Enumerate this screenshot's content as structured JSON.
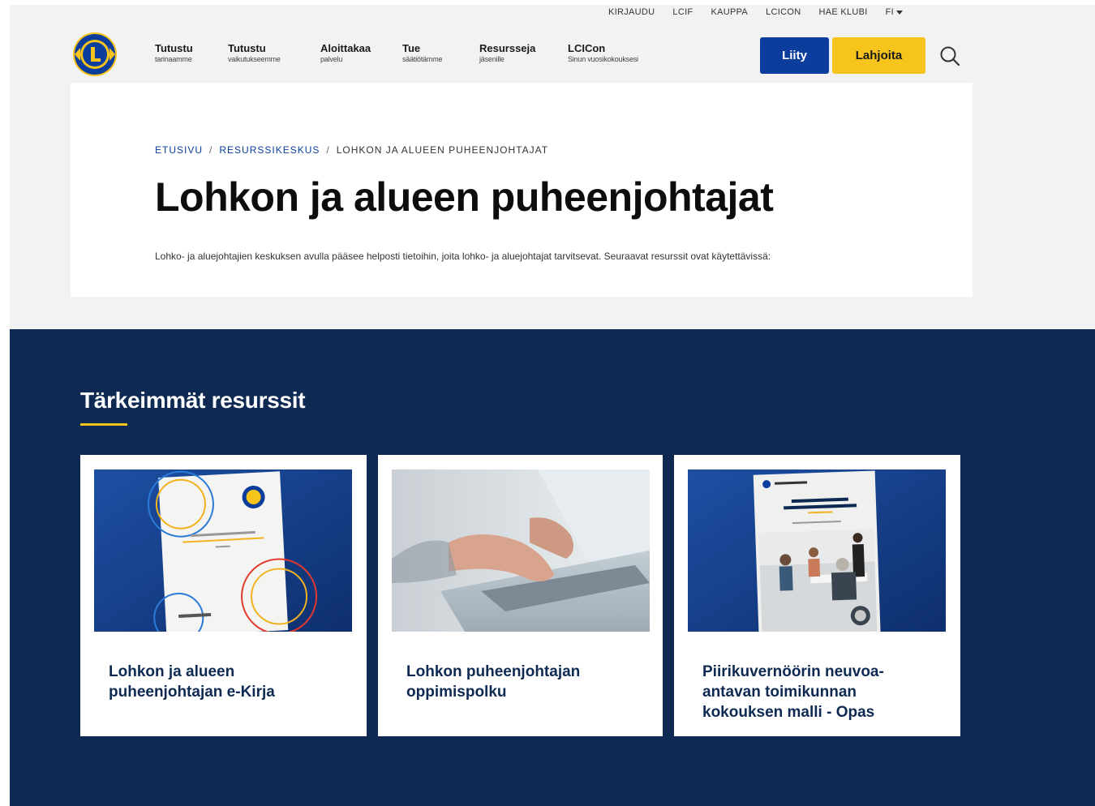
{
  "utility_nav": {
    "items": [
      "KIRJAUDU",
      "LCIF",
      "KAUPPA",
      "LCICON",
      "HAE KLUBI"
    ],
    "language": "FI"
  },
  "main_nav": {
    "items": [
      {
        "title": "Tutustu",
        "subtitle": "tarinaamme"
      },
      {
        "title": "Tutustu",
        "subtitle": "vaikutukseemme"
      },
      {
        "title": "Aloittakaa",
        "subtitle": "palvelu"
      },
      {
        "title": "Tue",
        "subtitle": "säätiötämme"
      },
      {
        "title": "Resursseja",
        "subtitle": "jäsenille"
      },
      {
        "title": "LCICon",
        "subtitle": "Sinun vuosikokouksesi"
      }
    ],
    "join_label": "Liity",
    "donate_label": "Lahjoita"
  },
  "breadcrumb": {
    "items": [
      "ETUSIVU",
      "RESURSSIKESKUS",
      "LOHKON JA ALUEEN PUHEENJOHTAJAT"
    ],
    "separator": "/"
  },
  "hero": {
    "title": "Lohkon ja alueen puheenjohtajat",
    "intro": "Lohko- ja aluejohtajien keskuksen avulla pääsee helposti tietoihin, joita lohko- ja aluejohtajat tarvitsevat. Seuraavat resurssit ovat käytettävissä:"
  },
  "resources": {
    "heading": "Tärkeimmät resurssit",
    "cards": [
      {
        "title": "Lohkon ja alueen puheenjohtajan e-Kirja"
      },
      {
        "title": "Lohkon puheenjohtajan oppimispolku"
      },
      {
        "title": "Piirikuvernöörin neuvoa-antavan toimikunnan kokouksen malli - Opas"
      }
    ]
  },
  "colors": {
    "brand_blue": "#0a3d9c",
    "brand_yellow": "#f7c31d",
    "navy": "#0e2a52",
    "light_gray": "#f2f2f2"
  }
}
